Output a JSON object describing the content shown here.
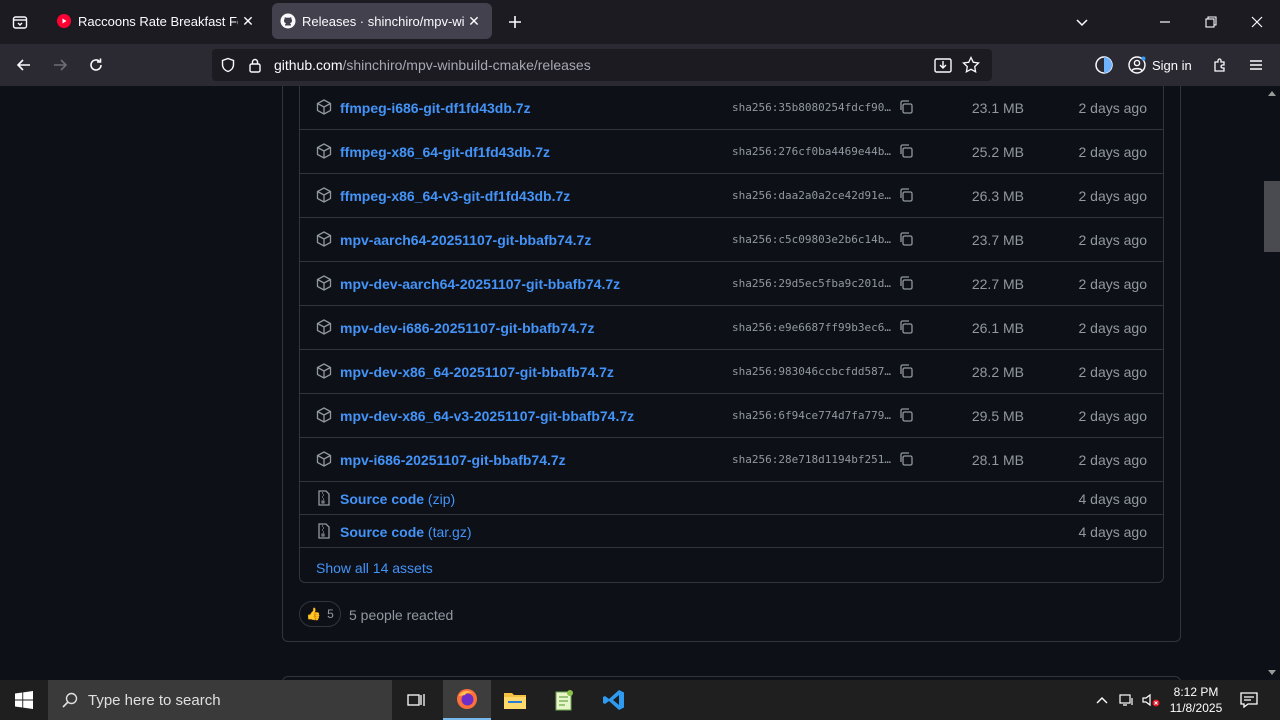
{
  "browser": {
    "tabs": [
      {
        "title": "Raccoons Rate Breakfast Foods! ",
        "active": false
      },
      {
        "title": "Releases · shinchiro/mpv-winbuild-cmake",
        "active": true
      }
    ],
    "url_host": "github.com",
    "url_path": "/shinchiro/mpv-winbuild-cmake/releases",
    "signin_label": "Sign in"
  },
  "assets": [
    {
      "name": "ffmpeg-i686-git-df1fd43db.7z",
      "sha": "sha256:35b8080254fdcf90…",
      "size": "23.1 MB",
      "date": "2 days ago"
    },
    {
      "name": "ffmpeg-x86_64-git-df1fd43db.7z",
      "sha": "sha256:276cf0ba4469e44b…",
      "size": "25.2 MB",
      "date": "2 days ago"
    },
    {
      "name": "ffmpeg-x86_64-v3-git-df1fd43db.7z",
      "sha": "sha256:daa2a0a2ce42d91e…",
      "size": "26.3 MB",
      "date": "2 days ago"
    },
    {
      "name": "mpv-aarch64-20251107-git-bbafb74.7z",
      "sha": "sha256:c5c09803e2b6c14b…",
      "size": "23.7 MB",
      "date": "2 days ago"
    },
    {
      "name": "mpv-dev-aarch64-20251107-git-bbafb74.7z",
      "sha": "sha256:29d5ec5fba9c201d…",
      "size": "22.7 MB",
      "date": "2 days ago"
    },
    {
      "name": "mpv-dev-i686-20251107-git-bbafb74.7z",
      "sha": "sha256:e9e6687ff99b3ec6…",
      "size": "26.1 MB",
      "date": "2 days ago"
    },
    {
      "name": "mpv-dev-x86_64-20251107-git-bbafb74.7z",
      "sha": "sha256:983046ccbcfdd587…",
      "size": "28.2 MB",
      "date": "2 days ago"
    },
    {
      "name": "mpv-dev-x86_64-v3-20251107-git-bbafb74.7z",
      "sha": "sha256:6f94ce774d7fa779…",
      "size": "29.5 MB",
      "date": "2 days ago"
    },
    {
      "name": "mpv-i686-20251107-git-bbafb74.7z",
      "sha": "sha256:28e718d1194bf251…",
      "size": "28.1 MB",
      "date": "2 days ago"
    }
  ],
  "source": [
    {
      "label": "Source code",
      "kind": "(zip)",
      "date": "4 days ago"
    },
    {
      "label": "Source code",
      "kind": "(tar.gz)",
      "date": "4 days ago"
    }
  ],
  "show_all": "Show all 14 assets",
  "reaction": {
    "emoji": "👍",
    "count": "5",
    "text": "5 people reacted"
  },
  "taskbar": {
    "search_placeholder": "Type here to search",
    "time": "8:12 PM",
    "date": "11/8/2025"
  },
  "colors": {
    "link": "#4493f8",
    "muted": "#9198a1",
    "border": "#30363d",
    "bg": "#0d1117"
  }
}
